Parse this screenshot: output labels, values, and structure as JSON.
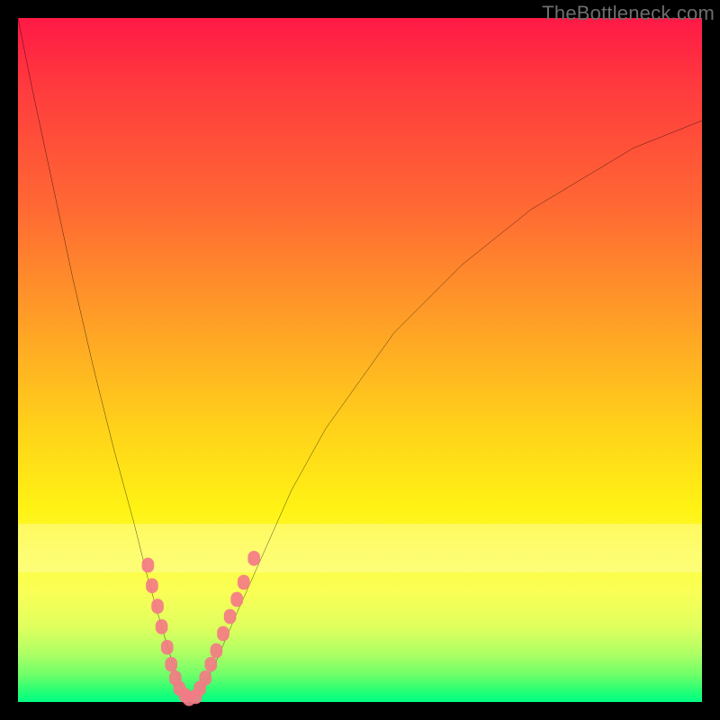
{
  "watermark": "TheBottleneck.com",
  "chart_data": {
    "type": "line",
    "title": "",
    "xlabel": "",
    "ylabel": "",
    "xlim": [
      0,
      100
    ],
    "ylim": [
      0,
      100
    ],
    "grid": false,
    "legend": "none",
    "series": [
      {
        "name": "bottleneck-curve",
        "color": "#000000",
        "x": [
          0,
          2,
          5,
          8,
          11,
          14,
          17,
          19,
          21,
          22.5,
          24,
          25.5,
          27,
          29,
          32,
          36,
          40,
          45,
          50,
          55,
          60,
          65,
          70,
          75,
          80,
          85,
          90,
          95,
          100
        ],
        "y": [
          100,
          90,
          76,
          62,
          49,
          37,
          26,
          18,
          11,
          6,
          2,
          0.5,
          2,
          6,
          13,
          22,
          31,
          40,
          47,
          54,
          59,
          64,
          68,
          72,
          75,
          78,
          81,
          83,
          85
        ]
      },
      {
        "name": "highlight-dots-left",
        "color": "#f47b86",
        "x": [
          19.0,
          19.6,
          20.4,
          21.0,
          21.8,
          22.4,
          23.0,
          23.6,
          24.4,
          25.0
        ],
        "y": [
          20.0,
          17.0,
          14.0,
          11.0,
          8.0,
          5.5,
          3.5,
          2.0,
          1.0,
          0.5
        ]
      },
      {
        "name": "highlight-dots-right",
        "color": "#f47b86",
        "x": [
          26.0,
          26.6,
          27.4,
          28.2,
          29.0,
          30.0,
          31.0,
          32.0,
          33.0,
          34.5
        ],
        "y": [
          0.8,
          2.0,
          3.5,
          5.5,
          7.5,
          10.0,
          12.5,
          15.0,
          17.5,
          21.0
        ]
      }
    ],
    "annotations": []
  }
}
